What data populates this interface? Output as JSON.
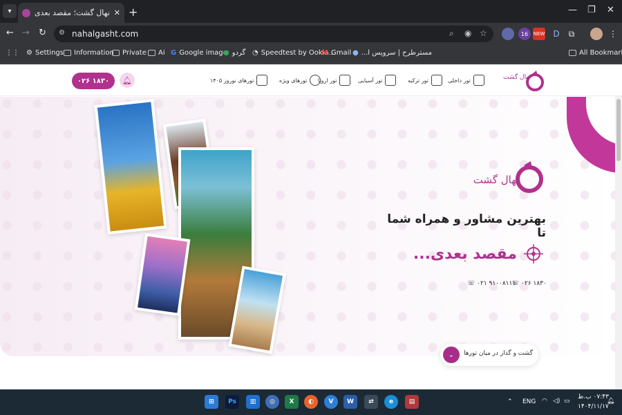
{
  "browser": {
    "tab_title": "نهال گشت؛ مقصد بعدی؟ | تور",
    "address": "nahalgasht.com",
    "ext_badges": [
      "16",
      "NEW",
      "D"
    ]
  },
  "bookmarks": [
    {
      "label": "Settings",
      "icon": "gear-icon"
    },
    {
      "label": "Information",
      "icon": "folder-icon"
    },
    {
      "label": "Private",
      "icon": "folder-icon"
    },
    {
      "label": "Ai",
      "icon": "folder-icon"
    },
    {
      "label": "Google image",
      "icon": "google-icon"
    },
    {
      "label": "گردو",
      "icon": "site-icon"
    },
    {
      "label": "Speedtest by Ookla...",
      "icon": "speedtest-icon"
    },
    {
      "label": "Gmail",
      "icon": "gmail-icon"
    },
    {
      "label": "مسترطرح | سرویس ا...",
      "icon": "site-icon"
    },
    {
      "label": "All Bookmarks",
      "icon": "folder-icon"
    }
  ],
  "site": {
    "phone_pill": "۰۲۶ ۱۸۳۰",
    "menu": [
      {
        "label": "تور داخلی",
        "icon": "tower-icon"
      },
      {
        "label": "تور ترکیه",
        "icon": "mosque-icon"
      },
      {
        "label": "تور آسیایی",
        "icon": "pagoda-icon"
      },
      {
        "label": "تور اروپا",
        "icon": "colosseum-icon"
      },
      {
        "label": "تورهای ویژه",
        "icon": "globe-icon"
      },
      {
        "label": "تورهای نوروز ۱۴۰۵",
        "icon": "plant-icon"
      }
    ],
    "logo_text": "نهال گشت",
    "hero": {
      "line1": "بهترین مشاور و همراه شما تا",
      "line2": "مقصد بعدی...",
      "phone1": "۰۲۶ ۱۸۳۰",
      "phone2": "۰۲۱ ۹۱۰۰۸۱۱۱",
      "cta": "گشت و گذار در میان تورها"
    }
  },
  "taskbar": {
    "lang": "ENG",
    "time": "۰۷:۴۳ ب.ظ",
    "date": "۱۴۰۴/۱۱/۱۷"
  },
  "colors": {
    "brand": "#b0318e",
    "brand_light": "#f4d6ec"
  }
}
